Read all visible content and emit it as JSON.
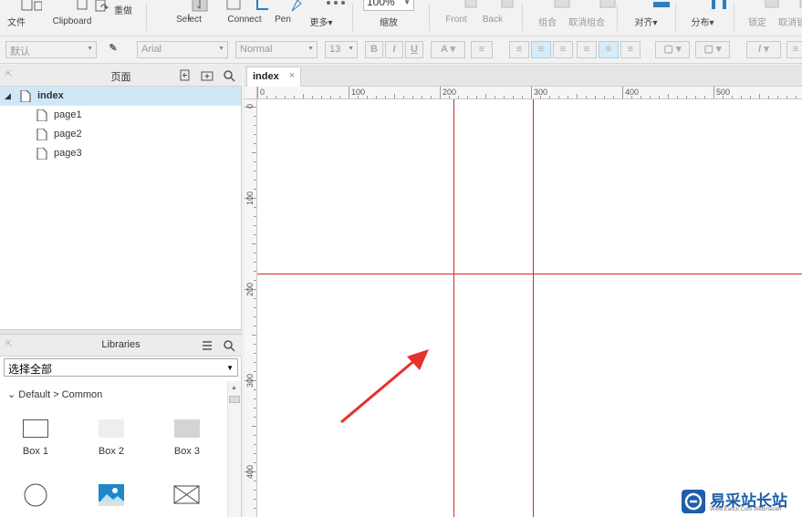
{
  "toolbar": {
    "file": "文件",
    "clipboard": "Clipboard",
    "redo": "重做",
    "select": "Select",
    "connect": "Connect",
    "pen": "Pen",
    "more": "更多",
    "zoom_value": "100%",
    "zoom_label": "缩放",
    "front": "Front",
    "back": "Back",
    "group": "组合",
    "ungroup": "取消组合",
    "align": "对齐",
    "distribute": "分布",
    "lock": "锁定",
    "unlock": "取消锁"
  },
  "format": {
    "style": "默认",
    "font": "Arial",
    "weight": "Normal",
    "size": "13",
    "bold": "B",
    "italic": "I",
    "underline": "U",
    "font_color": "A"
  },
  "pages": {
    "title": "页面",
    "items": [
      {
        "label": "index"
      },
      {
        "label": "page1"
      },
      {
        "label": "page2"
      },
      {
        "label": "page3"
      }
    ]
  },
  "libraries": {
    "title": "Libraries",
    "selected": "选择全部",
    "group": "Default > Common",
    "widgets": [
      {
        "label": "Box 1"
      },
      {
        "label": "Box 2"
      },
      {
        "label": "Box 3"
      }
    ]
  },
  "canvas": {
    "tab": "index",
    "tab_close": "×",
    "h_ruler": [
      "0",
      "100",
      "200",
      "300",
      "400",
      "500"
    ],
    "v_ruler": [
      "0",
      "100",
      "200",
      "300",
      "400"
    ]
  },
  "watermark": {
    "title": "易采站长站",
    "subtitle": "Www.Easck.Com  Webmaster"
  },
  "colors": {
    "guide": "#d9262b",
    "selection": "#cfe8f7",
    "arrow": "#e5322d"
  }
}
